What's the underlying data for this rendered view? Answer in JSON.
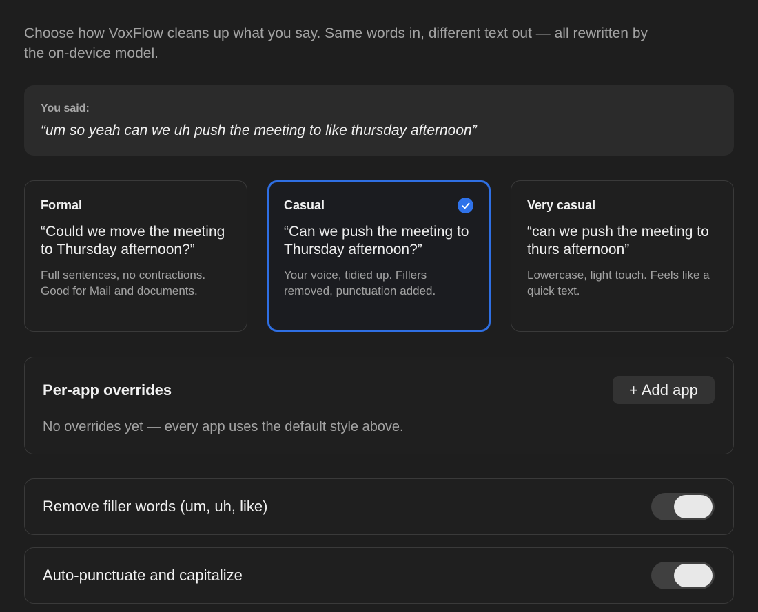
{
  "intro": "Choose how VoxFlow cleans up what you say. Same words in, different text out — all rewritten by the on-device model.",
  "you_said": {
    "label": "You said:",
    "quote": "“um so yeah can we uh push the meeting to like thursday afternoon”"
  },
  "styles": [
    {
      "name": "Formal",
      "example": "“Could we move the meeting to Thursday afternoon?”",
      "description": "Full sentences, no contractions. Good for Mail and documents.",
      "selected": false
    },
    {
      "name": "Casual",
      "example": "“Can we push the meeting to Thursday afternoon?”",
      "description": "Your voice, tidied up. Fillers removed, punctuation added.",
      "selected": true
    },
    {
      "name": "Very casual",
      "example": "“can we push the meeting to thurs afternoon”",
      "description": "Lowercase, light touch. Feels like a quick text.",
      "selected": false
    }
  ],
  "overrides": {
    "title": "Per-app overrides",
    "add_button": "+ Add app",
    "empty_text": "No overrides yet — every app uses the default style above."
  },
  "toggles": [
    {
      "label": "Remove filler words (um, uh, like)",
      "on": true
    },
    {
      "label": "Auto-punctuate and capitalize",
      "on": true
    }
  ],
  "colors": {
    "accent": "#2f6fe3",
    "background": "#1e1e1e"
  }
}
